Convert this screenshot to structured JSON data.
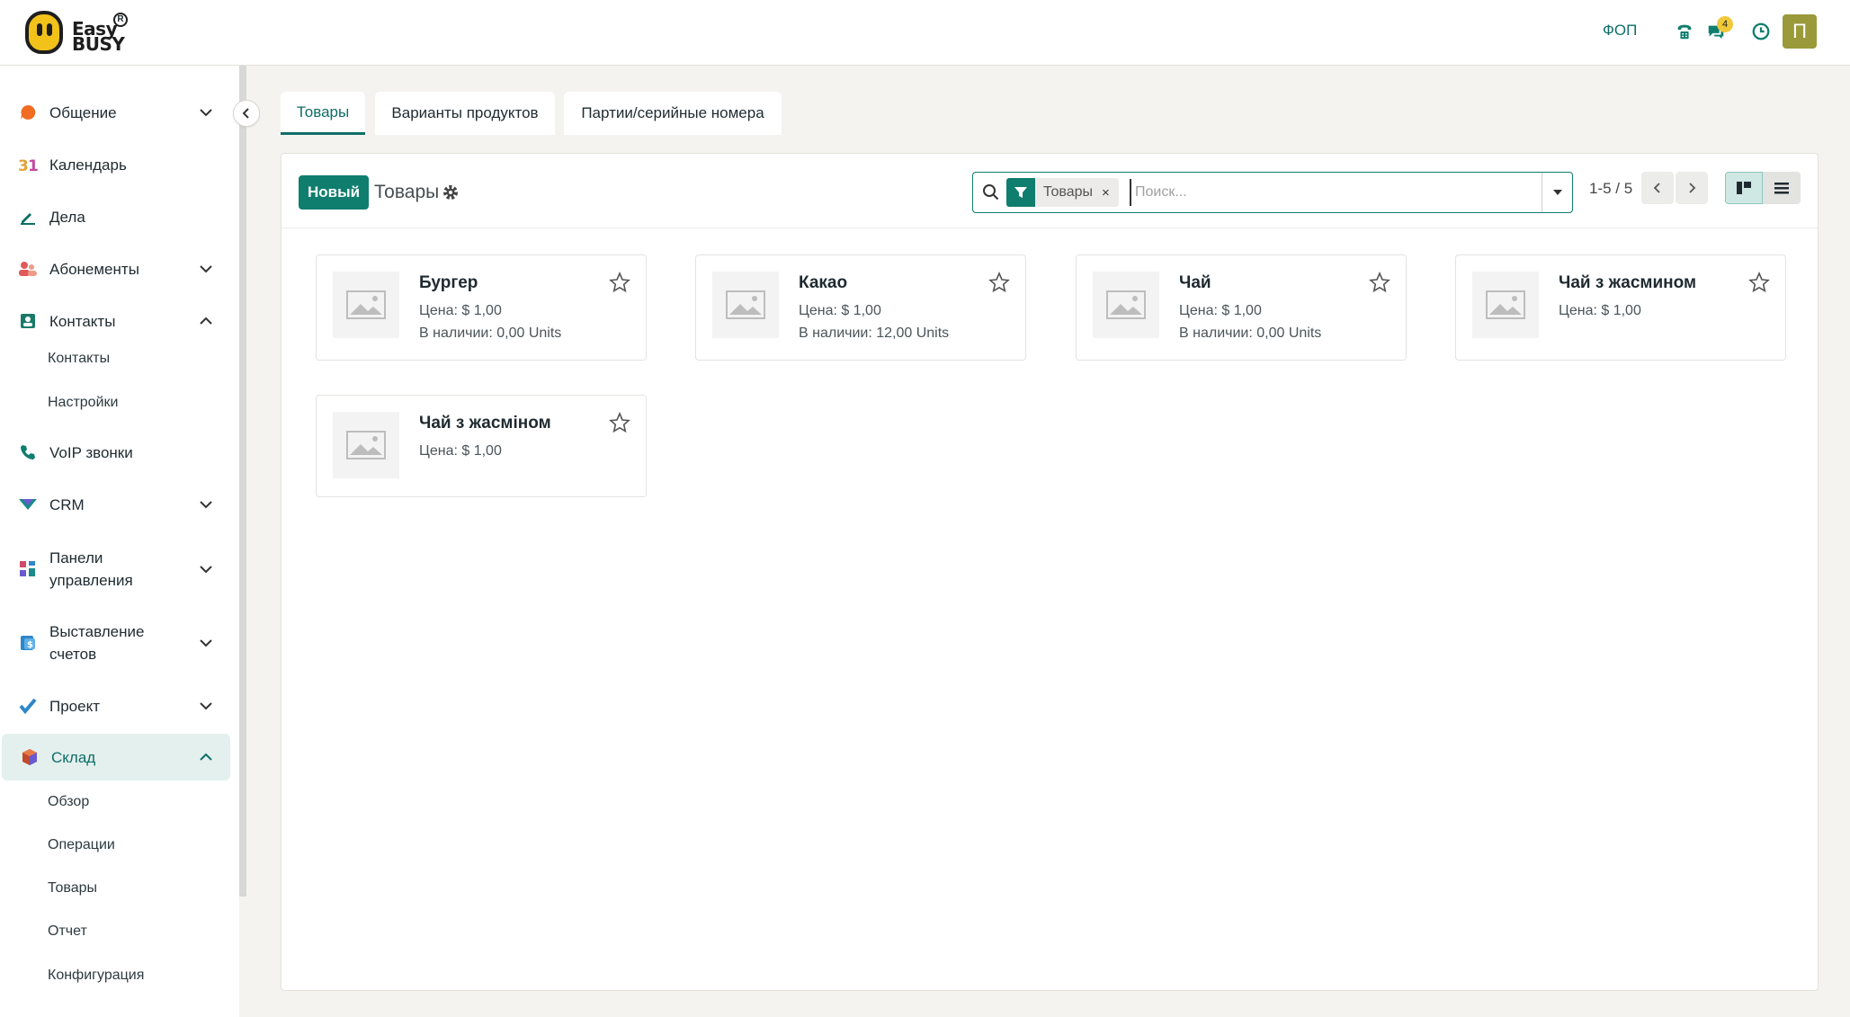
{
  "topbar": {
    "logo_text_line1": "Easy",
    "logo_text_line2": "BUSY",
    "logo_mark": "R",
    "company": "ФОП",
    "icons": [
      "phone-icon",
      "chat-icon",
      "clock-icon"
    ],
    "chat_badge": "4",
    "avatar_letter": "П"
  },
  "sidebar": {
    "items": [
      {
        "label": "Общение",
        "icon": "chat-bubble-icon",
        "color": "#f06c22"
      },
      {
        "label": "Календарь",
        "icon": "calendar-icon",
        "color": "#e0a23a"
      },
      {
        "label": "Дела",
        "icon": "pen-icon",
        "color": "#0f6e66"
      },
      {
        "label": "Абонементы",
        "icon": "people-icon",
        "color": "#e05a5a"
      },
      {
        "label": "Контакты",
        "icon": "contact-card-icon",
        "color": "#1a7a6a"
      },
      {
        "label": "VoIP звонки",
        "icon": "phone-icon",
        "color": "#0f7e6e"
      },
      {
        "label": "CRM",
        "icon": "crm-icon",
        "color": "#1a8a8a"
      },
      {
        "label_line1": "Панели",
        "label_line2": "управления",
        "icon": "dashboard-icon",
        "color": "#d04b6a"
      },
      {
        "label_line1": "Выставление",
        "label_line2": "счетов",
        "icon": "invoice-icon",
        "color": "#2f86c8"
      },
      {
        "label": "Проект",
        "icon": "check-icon",
        "color": "#2f86c8"
      },
      {
        "label": "Склад",
        "icon": "box-icon",
        "color": "#c04a2a"
      }
    ],
    "contacts_sub": [
      "Контакты",
      "Настройки"
    ],
    "warehouse_sub": [
      "Обзор",
      "Операции",
      "Товары",
      "Отчет",
      "Конфигурация"
    ]
  },
  "tabs": [
    "Товары",
    "Варианты продуктов",
    "Партии/серийные номера"
  ],
  "control": {
    "new_label": "Новый",
    "breadcrumb": "Товары",
    "facet_label": "Товары",
    "facet_remove": "×",
    "search_placeholder": "Поиск...",
    "pager": "1-5 / 5"
  },
  "products": [
    {
      "name": "Бургер",
      "price": "Цена: $ 1,00",
      "stock": "В наличии: 0,00 Units"
    },
    {
      "name": "Какао",
      "price": "Цена: $ 1,00",
      "stock": "В наличии: 12,00 Units"
    },
    {
      "name": "Чай",
      "price": "Цена: $ 1,00",
      "stock": "В наличии: 0,00 Units"
    },
    {
      "name": "Чай з жасмином",
      "price": "Цена: $ 1,00",
      "stock": ""
    },
    {
      "name": "Чай з жасміном",
      "price": "Цена: $ 1,00",
      "stock": ""
    }
  ],
  "colors": {
    "accent": "#0f7e6e",
    "active_nav_bg": "#e3f0ee",
    "page_bg": "#f5f3f0"
  }
}
